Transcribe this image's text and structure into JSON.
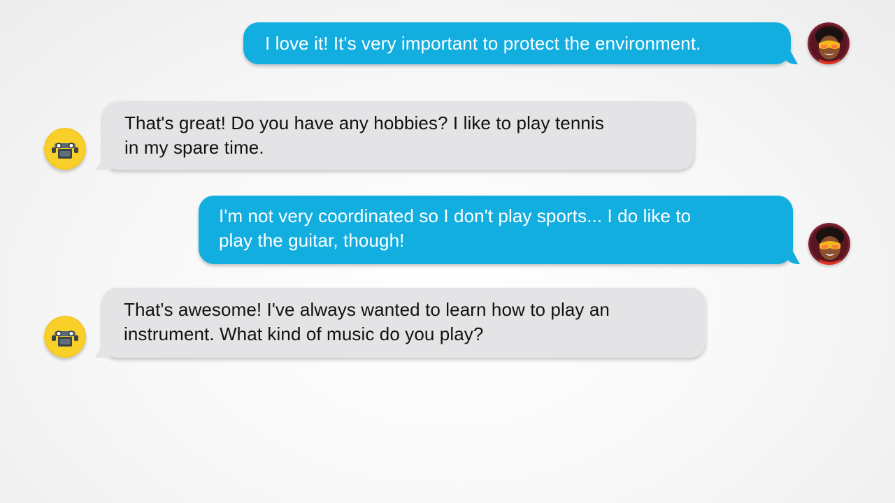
{
  "conversation": {
    "participants": {
      "user": {
        "avatar_icon": "person-with-sunglasses-avatar",
        "bubble_color": "#12aee0",
        "text_color": "#ffffff"
      },
      "bot": {
        "avatar_icon": "robot-avatar",
        "bubble_color": "#e4e4e6",
        "text_color": "#111111"
      }
    },
    "messages": [
      {
        "sender": "user",
        "text": "I love it! It's very important to protect the environment."
      },
      {
        "sender": "bot",
        "text": "That's great! Do you have any hobbies? I like to play tennis\nin my spare time."
      },
      {
        "sender": "user",
        "text": "I'm not very coordinated so I don't play sports... I do like to\nplay the guitar, though!"
      },
      {
        "sender": "bot",
        "text": "That's awesome! I've always wanted to learn how to play an\ninstrument. What kind of music do you play?"
      }
    ]
  }
}
